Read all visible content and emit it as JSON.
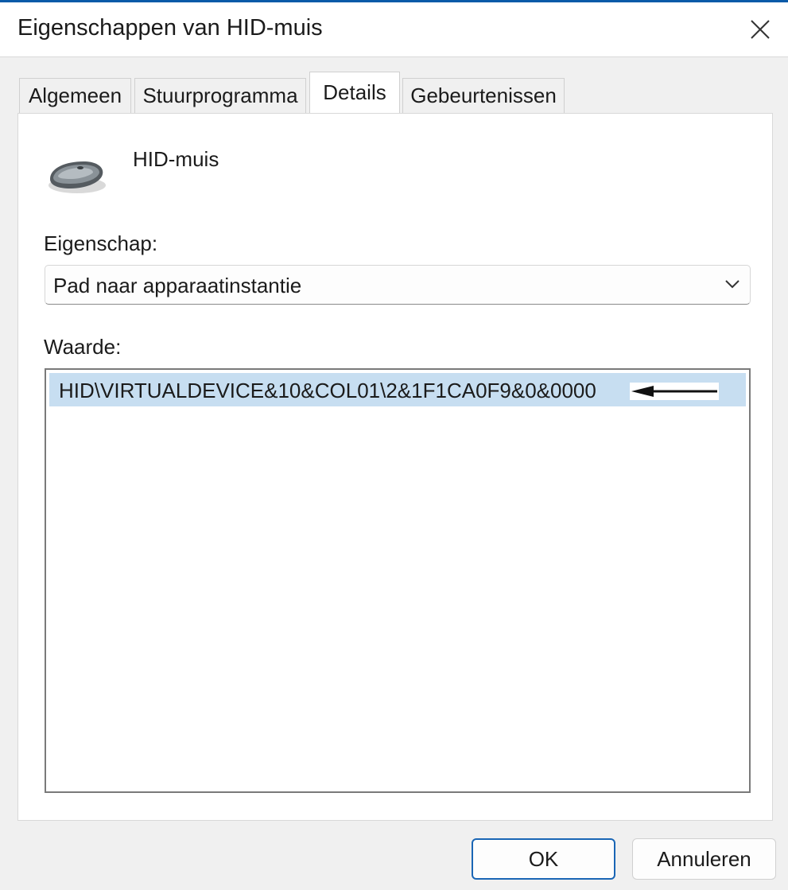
{
  "window": {
    "title": "Eigenschappen van HID-muis",
    "accent_color": "#0a5aa8",
    "close_icon": "close-icon"
  },
  "tabs": [
    {
      "label": "Algemeen",
      "active": false
    },
    {
      "label": "Stuurprogramma",
      "active": false
    },
    {
      "label": "Details",
      "active": true
    },
    {
      "label": "Gebeurtenissen",
      "active": false
    }
  ],
  "device": {
    "icon": "mouse-icon",
    "name": "HID-muis"
  },
  "property": {
    "label": "Eigenschap:",
    "selected": "Pad naar apparaatinstantie"
  },
  "value": {
    "label": "Waarde:",
    "items": [
      "HID\\VIRTUALDEVICE&10&COL01\\2&1F1CA0F9&0&0000"
    ],
    "selected_color": "#c7def1"
  },
  "buttons": {
    "ok": "OK",
    "cancel": "Annuleren"
  }
}
